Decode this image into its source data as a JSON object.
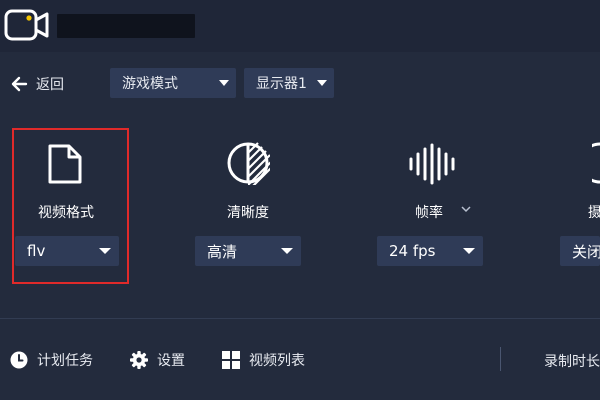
{
  "app": {
    "logo_icon": "video-camera-icon"
  },
  "nav": {
    "back_label": "返回",
    "mode_select": "游戏模式",
    "display_select": "显示器1"
  },
  "features": {
    "format": {
      "label": "视频格式",
      "value": "flv",
      "icon": "file-icon"
    },
    "clarity": {
      "label": "清晰度",
      "value": "高清",
      "icon": "half-circle-icon"
    },
    "framerate": {
      "label": "帧率",
      "value": "24 fps",
      "icon": "audio-wave-icon",
      "info_icon": "chevron-down-icon"
    },
    "fourth": {
      "label": "摄",
      "value": "关闭"
    }
  },
  "bottom": {
    "schedule_label": "计划任务",
    "settings_label": "设置",
    "video_list_label": "视频列表",
    "record_duration_label": "录制时长"
  },
  "colors": {
    "background": "#232b3d",
    "select_bg": "#2f3b57",
    "highlight": "#e02a2a",
    "logo_accent": "#f2c200"
  }
}
